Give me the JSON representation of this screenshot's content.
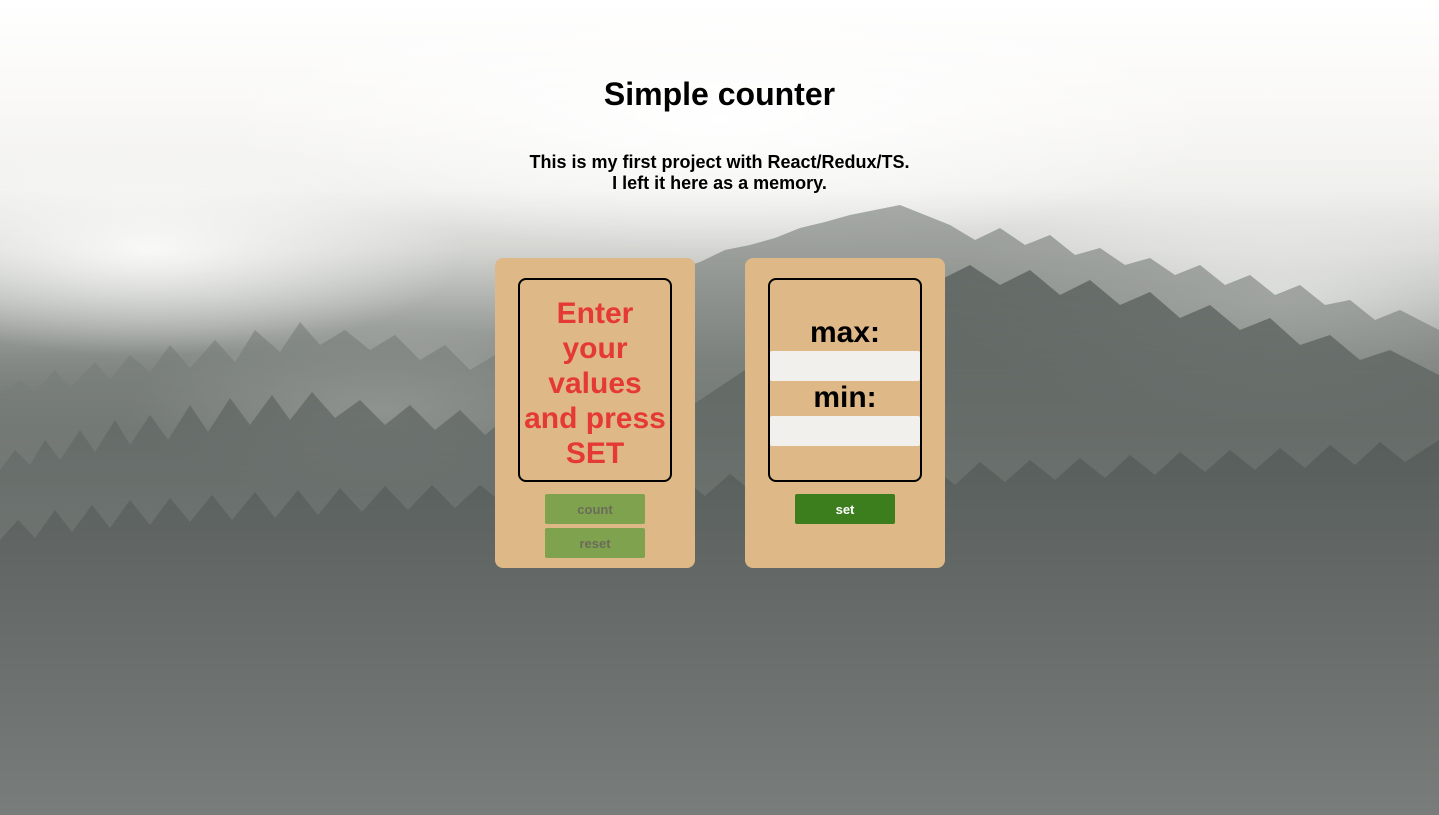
{
  "page": {
    "title": "Simple counter",
    "description_line1": "This is my first project with React/Redux/TS.",
    "description_line2": "I left it here as a memory."
  },
  "counter": {
    "message": "Enter your values and press SET",
    "message_color": "#e53935",
    "count_label": "count",
    "reset_label": "reset",
    "count_disabled": true,
    "reset_disabled": true
  },
  "settings": {
    "max_label": "max:",
    "max_value": "",
    "min_label": "min:",
    "min_value": "",
    "set_label": "set"
  },
  "colors": {
    "card_background": "#deb887",
    "set_button": "#3c7d1e",
    "disabled_button": "#7fa24f"
  }
}
